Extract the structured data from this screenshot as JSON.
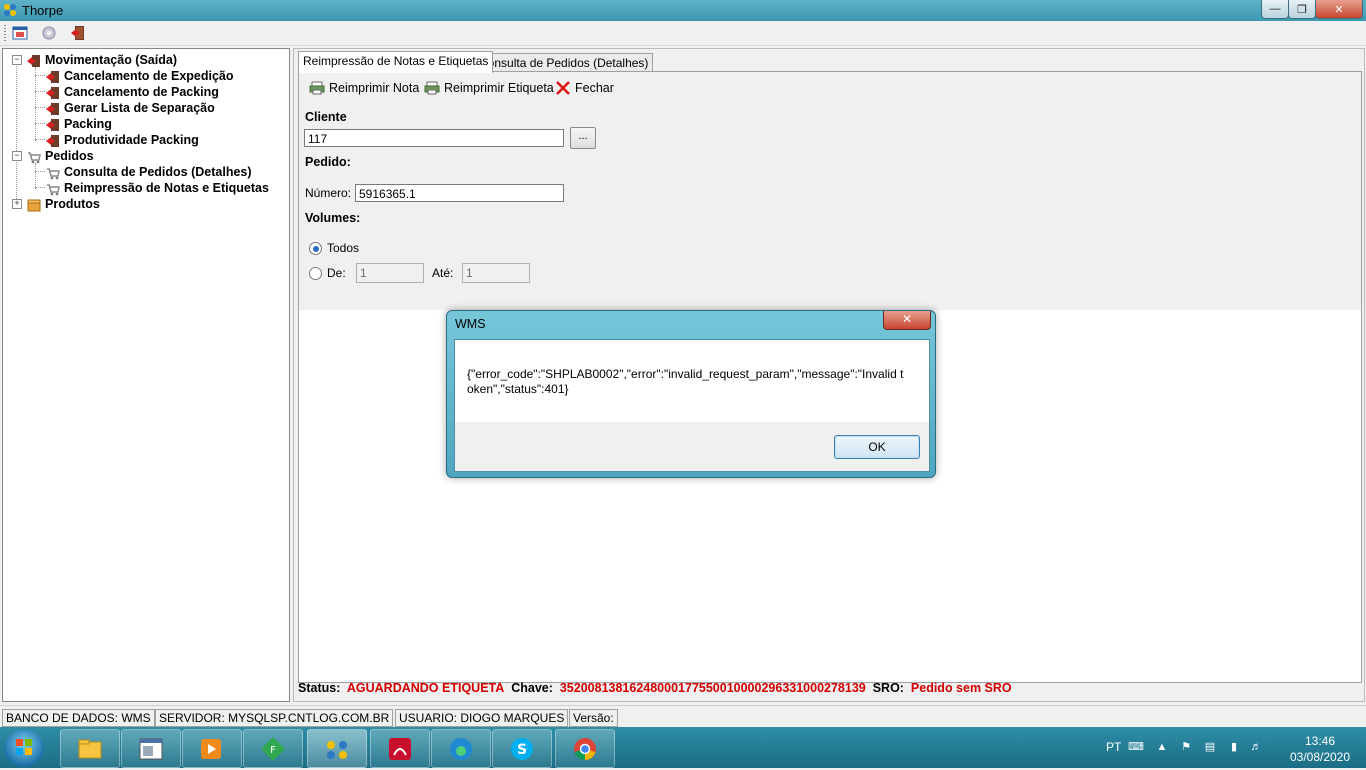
{
  "window": {
    "title": "Thorpe"
  },
  "tree": {
    "items": [
      {
        "label": "Movimentação (Saída)",
        "icon": "exit-icon"
      },
      {
        "label": "Cancelamento de Expedição",
        "icon": "exit-icon"
      },
      {
        "label": "Cancelamento de Packing",
        "icon": "exit-icon"
      },
      {
        "label": "Gerar Lista de Separação",
        "icon": "exit-icon"
      },
      {
        "label": "Packing",
        "icon": "exit-icon"
      },
      {
        "label": "Produtividade Packing",
        "icon": "exit-icon"
      },
      {
        "label": "Pedidos",
        "icon": "cart-icon"
      },
      {
        "label": "Consulta de Pedidos (Detalhes)",
        "icon": "cart-icon"
      },
      {
        "label": "Reimpressão de Notas e Etiquetas",
        "icon": "cart-icon"
      },
      {
        "label": "Produtos",
        "icon": "box-icon"
      }
    ]
  },
  "tabs": [
    {
      "label": "Reimpressão de Notas e Etiquetas"
    },
    {
      "label": "Consulta de Pedidos (Detalhes)"
    }
  ],
  "actions": {
    "reprint_note": "Reimprimir Nota",
    "reprint_label": "Reimprimir Etiqueta",
    "close": "Fechar"
  },
  "form": {
    "cliente_label": "Cliente",
    "cliente_value": "117",
    "browse_label": "...",
    "pedido_label": "Pedido:",
    "numero_label": "Número:",
    "numero_value": "5916365.1",
    "volumes_label": "Volumes:",
    "todos_label": "Todos",
    "de_label": "De:",
    "de_value": "1",
    "ate_label": "Até:",
    "ate_value": "1"
  },
  "status": {
    "status_key": "Status:",
    "status_value": "AGUARDANDO ETIQUETA",
    "chave_key": "Chave:",
    "chave_value": "35200813816248000177550010000296331000278139",
    "sro_key": "SRO:",
    "sro_value": "Pedido sem SRO"
  },
  "statusbar": {
    "db": "BANCO DE DADOS: WMS",
    "server": "SERVIDOR: MYSQLSP.CNTLOG.COM.BR",
    "user": "USUARIO: DIOGO MARQUES",
    "version": "Versão:"
  },
  "dialog": {
    "title": "WMS",
    "message": "{\"error_code\":\"SHPLAB0002\",\"error\":\"invalid_request_param\",\"message\":\"Invalid token\",\"status\":401}",
    "ok": "OK"
  },
  "taskbar": {
    "lang": "PT",
    "time": "13:46",
    "date": "03/08/2020"
  },
  "colors": {
    "accent_red": "#d40000",
    "title_bar": "#4aa7bf"
  }
}
